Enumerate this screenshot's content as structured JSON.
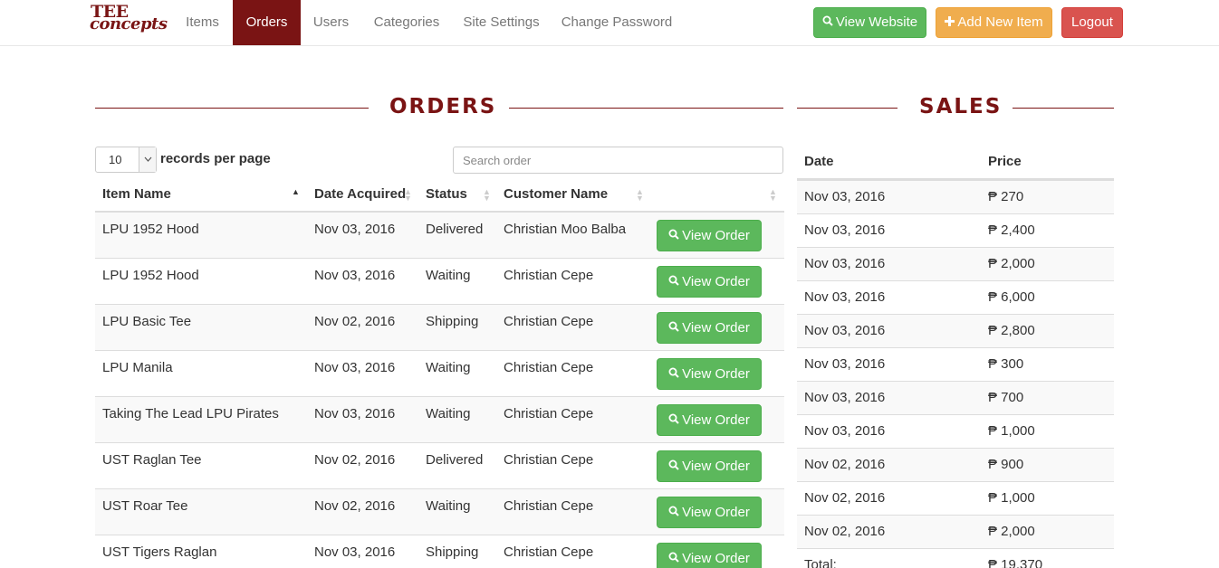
{
  "brand": {
    "line1": "TEE",
    "line2": "concepts"
  },
  "nav": {
    "items": [
      {
        "label": "Items"
      },
      {
        "label": "Orders"
      },
      {
        "label": "Users"
      },
      {
        "label": "Categories"
      },
      {
        "label": "Site Settings"
      },
      {
        "label": "Change Password"
      }
    ],
    "active": "Orders",
    "view_website": "View Website",
    "add_item": "Add New Item",
    "logout": "Logout"
  },
  "orders": {
    "title": "ORDERS",
    "page_size": "10",
    "records_label": "records per page",
    "search_placeholder": "Search order",
    "columns": [
      "Item Name",
      "Date Acquired",
      "Status",
      "Customer Name"
    ],
    "button_label": "View Order",
    "rows": [
      {
        "item": "LPU 1952 Hood",
        "date": "Nov 03, 2016",
        "status": "Delivered",
        "customer": "Christian Moo Balba"
      },
      {
        "item": "LPU 1952 Hood",
        "date": "Nov 03, 2016",
        "status": "Waiting",
        "customer": "Christian Cepe"
      },
      {
        "item": "LPU Basic Tee",
        "date": "Nov 02, 2016",
        "status": "Shipping",
        "customer": "Christian Cepe"
      },
      {
        "item": "LPU Manila",
        "date": "Nov 03, 2016",
        "status": "Waiting",
        "customer": "Christian Cepe"
      },
      {
        "item": "Taking The Lead LPU Pirates",
        "date": "Nov 03, 2016",
        "status": "Waiting",
        "customer": "Christian Cepe"
      },
      {
        "item": "UST Raglan Tee",
        "date": "Nov 02, 2016",
        "status": "Delivered",
        "customer": "Christian Cepe"
      },
      {
        "item": "UST Roar Tee",
        "date": "Nov 02, 2016",
        "status": "Waiting",
        "customer": "Christian Cepe"
      },
      {
        "item": "UST Tigers Raglan",
        "date": "Nov 03, 2016",
        "status": "Shipping",
        "customer": "Christian Cepe"
      }
    ]
  },
  "sales": {
    "title": "SALES",
    "columns": [
      "Date",
      "Price"
    ],
    "rows": [
      {
        "date": "Nov 03, 2016",
        "price": "₱ 270"
      },
      {
        "date": "Nov 03, 2016",
        "price": "₱ 2,400"
      },
      {
        "date": "Nov 03, 2016",
        "price": "₱ 2,000"
      },
      {
        "date": "Nov 03, 2016",
        "price": "₱ 6,000"
      },
      {
        "date": "Nov 03, 2016",
        "price": "₱ 2,800"
      },
      {
        "date": "Nov 03, 2016",
        "price": "₱ 300"
      },
      {
        "date": "Nov 03, 2016",
        "price": "₱ 700"
      },
      {
        "date": "Nov 03, 2016",
        "price": "₱ 1,000"
      },
      {
        "date": "Nov 02, 2016",
        "price": "₱ 900"
      },
      {
        "date": "Nov 02, 2016",
        "price": "₱ 1,000"
      },
      {
        "date": "Nov 02, 2016",
        "price": "₱ 2,000"
      }
    ],
    "total_label": "Total:",
    "total_value": "₱ 19,370"
  },
  "colors": {
    "brand": "#7a1414",
    "success": "#5cb85c",
    "warning": "#f0ad4e",
    "danger": "#d9534f"
  },
  "icons": {
    "view_website": "search-icon",
    "add_item": "plus-icon",
    "view_order": "search-icon",
    "sort": "sort-icon"
  }
}
